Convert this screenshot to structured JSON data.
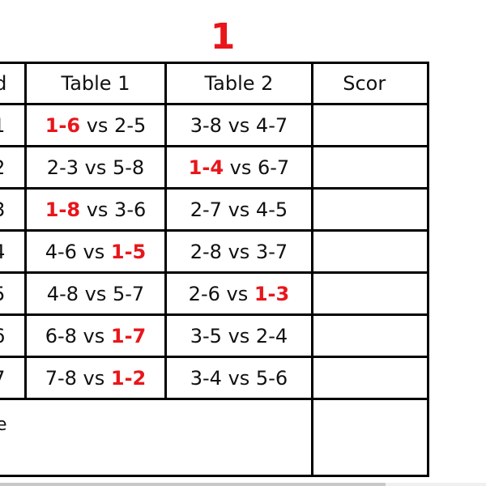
{
  "title": "1",
  "colors": {
    "highlight": "#e8161b",
    "text": "#111111",
    "border": "#000000"
  },
  "headers": {
    "round": "und",
    "table1": "Table 1",
    "table2": "Table 2",
    "score": "Scor"
  },
  "rows": [
    {
      "round": "1",
      "t1": [
        {
          "text": "1-6",
          "hl": true
        },
        {
          "text": " vs ",
          "hl": false
        },
        {
          "text": "2-5",
          "hl": false
        }
      ],
      "t2": [
        {
          "text": "3-8",
          "hl": false
        },
        {
          "text": " vs ",
          "hl": false
        },
        {
          "text": "4-7",
          "hl": false
        }
      ],
      "score": ""
    },
    {
      "round": "2",
      "t1": [
        {
          "text": "2-3",
          "hl": false
        },
        {
          "text": " vs ",
          "hl": false
        },
        {
          "text": "5-8",
          "hl": false
        }
      ],
      "t2": [
        {
          "text": "1-4",
          "hl": true
        },
        {
          "text": " vs ",
          "hl": false
        },
        {
          "text": "6-7",
          "hl": false
        }
      ],
      "score": ""
    },
    {
      "round": "3",
      "t1": [
        {
          "text": "1-8",
          "hl": true
        },
        {
          "text": " vs ",
          "hl": false
        },
        {
          "text": "3-6",
          "hl": false
        }
      ],
      "t2": [
        {
          "text": "2-7",
          "hl": false
        },
        {
          "text": " vs ",
          "hl": false
        },
        {
          "text": "4-5",
          "hl": false
        }
      ],
      "score": ""
    },
    {
      "round": "4",
      "t1": [
        {
          "text": "4-6",
          "hl": false
        },
        {
          "text": " vs ",
          "hl": false
        },
        {
          "text": "1-5",
          "hl": true
        }
      ],
      "t2": [
        {
          "text": "2-8",
          "hl": false
        },
        {
          "text": " vs ",
          "hl": false
        },
        {
          "text": "3-7",
          "hl": false
        }
      ],
      "score": ""
    },
    {
      "round": "5",
      "t1": [
        {
          "text": "4-8",
          "hl": false
        },
        {
          "text": " vs ",
          "hl": false
        },
        {
          "text": "5-7",
          "hl": false
        }
      ],
      "t2": [
        {
          "text": "2-6",
          "hl": false
        },
        {
          "text": " vs ",
          "hl": false
        },
        {
          "text": "1-3",
          "hl": true
        }
      ],
      "score": ""
    },
    {
      "round": "6",
      "t1": [
        {
          "text": "6-8",
          "hl": false
        },
        {
          "text": " vs ",
          "hl": false
        },
        {
          "text": "1-7",
          "hl": true
        }
      ],
      "t2": [
        {
          "text": "3-5",
          "hl": false
        },
        {
          "text": " vs ",
          "hl": false
        },
        {
          "text": "2-4",
          "hl": false
        }
      ],
      "score": ""
    },
    {
      "round": "7",
      "t1": [
        {
          "text": "7-8",
          "hl": false
        },
        {
          "text": " vs ",
          "hl": false
        },
        {
          "text": "1-2",
          "hl": true
        }
      ],
      "t2": [
        {
          "text": "3-4",
          "hl": false
        },
        {
          "text": " vs ",
          "hl": false
        },
        {
          "text": "5-6",
          "hl": false
        }
      ],
      "score": ""
    }
  ],
  "total_row": {
    "label": "ne",
    "score": ""
  }
}
